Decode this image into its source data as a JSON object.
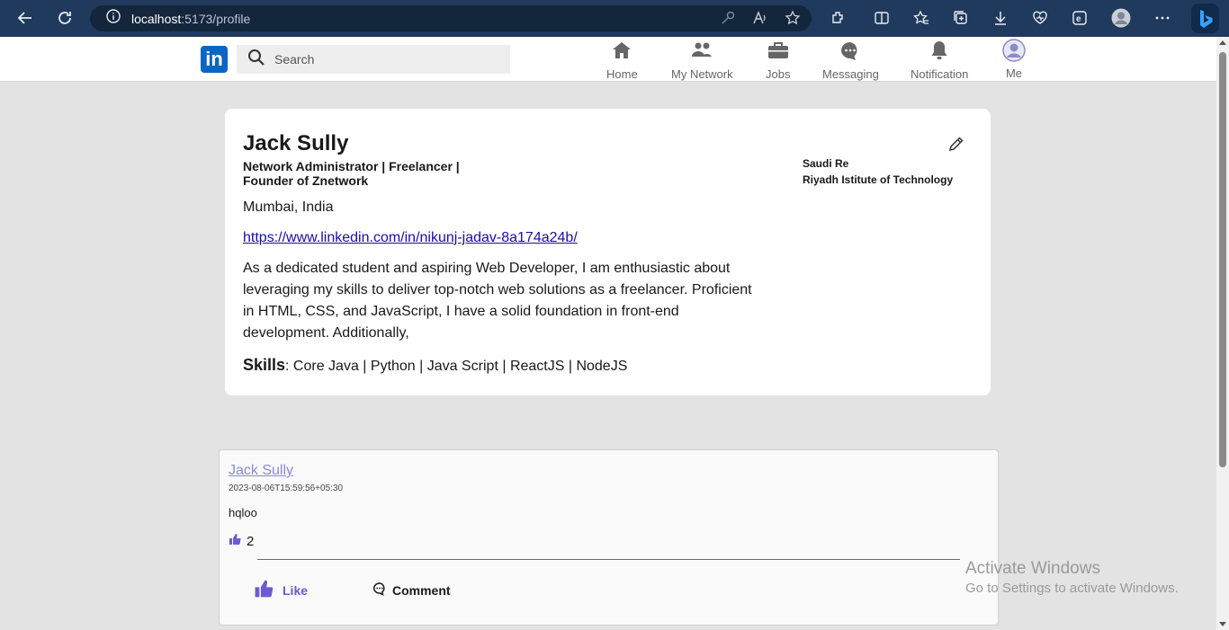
{
  "browser": {
    "url_host": "localhost",
    "url_rest": ":5173/profile"
  },
  "header": {
    "logo_text": "in",
    "search_placeholder": "Search",
    "nav": [
      {
        "label": "Home",
        "icon": "home-icon"
      },
      {
        "label": "My Network",
        "icon": "people-icon"
      },
      {
        "label": "Jobs",
        "icon": "briefcase-icon"
      },
      {
        "label": "Messaging",
        "icon": "chat-icon"
      },
      {
        "label": "Notification",
        "icon": "bell-icon"
      },
      {
        "label": "Me",
        "icon": "avatar-icon"
      }
    ]
  },
  "profile": {
    "name": "Jack Sully",
    "headline": "Network Administrator | Freelancer | Founder of Znetwork",
    "location": "Mumbai, India",
    "link": "https://www.linkedin.com/in/nikunj-jadav-8a174a24b/",
    "about": "As a dedicated student and aspiring Web Developer, I am enthusiastic about leveraging my skills to deliver top-notch web solutions as a freelancer. Proficient in HTML, CSS, and JavaScript, I have a solid foundation in front-end development. Additionally,",
    "skills_label": "Skills",
    "skills": ": Core Java | Python | Java Script | ReactJS | NodeJS",
    "company": "Saudi Re",
    "college": "Riyadh Istitute of Technology"
  },
  "post": {
    "author": "Jack Sully",
    "timestamp": "2023-08-06T15:59:56+05:30",
    "body": "hqloo",
    "like_count": "2",
    "like_label": "Like",
    "comment_label": "Comment"
  },
  "watermark": {
    "title": "Activate Windows",
    "subtitle": "Go to Settings to activate Windows."
  },
  "colors": {
    "brand": "#0a66c2",
    "like_accent": "#6a5ad4",
    "browser_bar": "#1f3a5c"
  }
}
